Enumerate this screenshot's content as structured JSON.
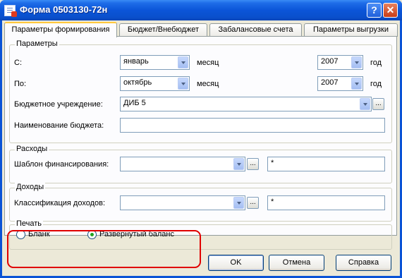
{
  "window": {
    "title": "Форма 0503130-72н",
    "help_label": "?",
    "close_label": "✕"
  },
  "tabs": [
    {
      "label": "Параметры формирования",
      "active": true
    },
    {
      "label": "Бюджет/Внебюджет",
      "active": false
    },
    {
      "label": "Забалансовые счета",
      "active": false
    },
    {
      "label": "Параметры выгрузки",
      "active": false
    }
  ],
  "params": {
    "group_label": "Параметры",
    "from_label": "С:",
    "from_month": "январь",
    "from_month_unit": "месяц",
    "from_year": "2007",
    "from_year_unit": "год",
    "to_label": "По:",
    "to_month": "октябрь",
    "to_month_unit": "месяц",
    "to_year": "2007",
    "to_year_unit": "год",
    "institution_label": "Бюджетное учреждение:",
    "institution_value": "ДИБ 5",
    "budget_name_label": "Наименование бюджета:",
    "budget_name_value": ""
  },
  "expenses": {
    "group_label": "Расходы",
    "template_label": "Шаблон финансирования:",
    "template_value": "",
    "filter_value": "*"
  },
  "income": {
    "group_label": "Доходы",
    "class_label": "Классификация доходов:",
    "class_value": "",
    "filter_value": "*"
  },
  "print": {
    "group_label": "Печать",
    "options": [
      {
        "label": "Бланк",
        "selected": false
      },
      {
        "label": "Развернутый баланс",
        "selected": true
      }
    ]
  },
  "buttons": {
    "ok": "OK",
    "cancel": "Отмена",
    "help": "Справка"
  },
  "ellipsis_label": "..."
}
